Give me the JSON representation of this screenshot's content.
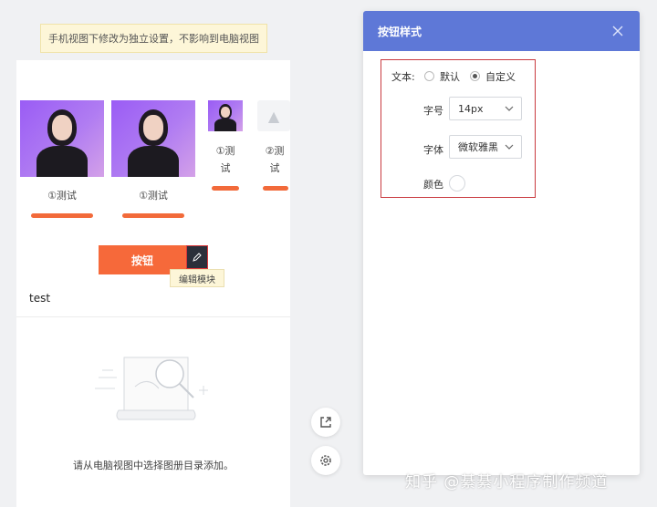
{
  "notice": {
    "text": "手机视图下修改为独立设置，不影响到电脑视图"
  },
  "gallery": {
    "items": [
      {
        "caption": "①测试"
      },
      {
        "caption": "①测试"
      },
      {
        "caption_line1": "①测",
        "caption_line2": "试"
      },
      {
        "caption_line1": "②测",
        "caption_line2": "试"
      }
    ]
  },
  "button_module": {
    "label": "按钮",
    "tooltip": "编辑模块"
  },
  "test_text": "test",
  "empty_state": {
    "message": "请从电脑视图中选择图册目录添加。"
  },
  "panel": {
    "title": "按钮样式",
    "text_label": "文本:",
    "text_options": [
      {
        "label": "默认",
        "selected": false
      },
      {
        "label": "自定义",
        "selected": true
      }
    ],
    "size_label": "字号",
    "size_value": "14px",
    "font_label": "字体",
    "font_value": "微软雅黑",
    "color_label": "颜色"
  },
  "watermark": "知乎 @綦綦小程序制作频道",
  "colors": {
    "accent_orange": "#f6693a",
    "panel_header": "#5e78d7",
    "highlight_border": "#c93a3f"
  }
}
